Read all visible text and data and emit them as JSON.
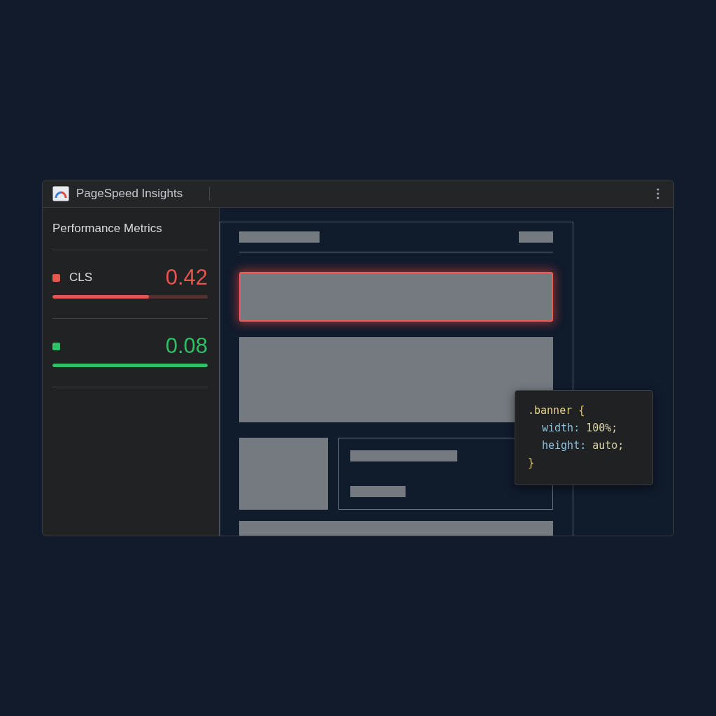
{
  "window": {
    "title": "PageSpeed Insights"
  },
  "sidebar": {
    "heading": "Performance Metrics",
    "metrics": [
      {
        "label": "CLS",
        "value": "0.42",
        "level": 0.62,
        "color": "#e8554e"
      },
      {
        "value": "0.08",
        "level": 1,
        "color": "#2fbf64"
      }
    ]
  },
  "preview": {
    "banner_highlighted": true
  },
  "code_popup": {
    "lines": [
      {
        "indented": false,
        "tokens": [
          {
            "kind": "selector",
            "text": ".banner"
          },
          {
            "kind": "brace",
            "text": "{"
          }
        ]
      },
      {
        "indented": true,
        "tokens": [
          {
            "kind": "property",
            "text": "width:"
          },
          {
            "kind": "value",
            "text": "100%;"
          }
        ]
      },
      {
        "indented": true,
        "tokens": [
          {
            "kind": "property",
            "text": "height:"
          },
          {
            "kind": "value",
            "text": "auto;"
          }
        ]
      },
      {
        "indented": false,
        "tokens": [
          {
            "kind": "brace",
            "text": "}"
          }
        ]
      }
    ]
  }
}
